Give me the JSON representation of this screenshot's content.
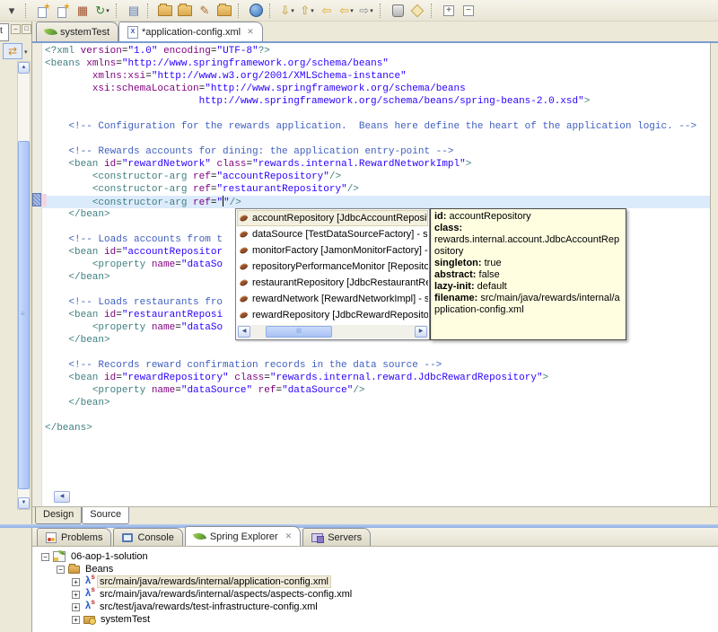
{
  "toolbar": {
    "groups": [
      [
        {
          "name": "cropped-overflow-dropdown",
          "glyph": "▾",
          "color": "#444444"
        }
      ],
      [
        {
          "name": "new-wizard",
          "cls": "g-star"
        },
        {
          "name": "new-bean-wizard",
          "cls": "g-star"
        },
        {
          "name": "new-package",
          "glyph": "▦",
          "color": "#a0522d"
        },
        {
          "name": "refresh",
          "glyph": "↻",
          "color": "#2f7f2f",
          "dd": true
        }
      ],
      [
        {
          "name": "open-view",
          "glyph": "▤",
          "color": "#5a7ab8"
        }
      ],
      [
        {
          "name": "open-resource-folder",
          "cls": "g-folder"
        },
        {
          "name": "import-folder",
          "cls": "g-folder"
        },
        {
          "name": "paintbrush",
          "glyph": "✎",
          "color": "#b06a2a"
        },
        {
          "name": "folder",
          "cls": "g-folder"
        }
      ],
      [
        {
          "name": "web-browser",
          "cls": "g-globe"
        }
      ],
      [
        {
          "name": "import",
          "glyph": "⇩",
          "color": "#b8962a",
          "dd": true
        },
        {
          "name": "export",
          "glyph": "⇧",
          "color": "#b8962a",
          "dd": true
        },
        {
          "name": "last-edit-location",
          "glyph": "⇦",
          "color": "#e0a72a"
        },
        {
          "name": "back",
          "glyph": "⇦",
          "color": "#e0a72a",
          "dd": true
        },
        {
          "name": "forward",
          "glyph": "⇨",
          "color": "#8a8f98",
          "dd": true
        }
      ],
      [
        {
          "name": "run-jar",
          "cls": "g-jar"
        },
        {
          "name": "bookmark-tag",
          "cls": "g-tag"
        }
      ],
      [
        {
          "name": "expand-all",
          "cls": "g-plus"
        },
        {
          "name": "collapse-all",
          "cls": "g-minus"
        }
      ]
    ]
  },
  "left_panel": {
    "truncated_tab_label": "t",
    "minimize_glyph": "–",
    "maximize_glyph": "□",
    "link_with_editor_glyph": "⇄",
    "menu_glyph": "▾"
  },
  "editor_tabs": [
    {
      "label": "systemTest",
      "icon": "spring-leaf-icon",
      "active": false
    },
    {
      "label": "*application-config.xml",
      "icon": "xml-file-icon",
      "active": true,
      "close_glyph": "✕"
    }
  ],
  "editor": {
    "cursor_line": 12,
    "lines": [
      [
        [
          "t",
          "<?xml "
        ],
        [
          "a",
          "version"
        ],
        [
          "x",
          "="
        ],
        [
          "v",
          "\"1.0\""
        ],
        [
          "x",
          " "
        ],
        [
          "a",
          "encoding"
        ],
        [
          "x",
          "="
        ],
        [
          "v",
          "\"UTF-8\""
        ],
        [
          "t",
          "?>"
        ]
      ],
      [
        [
          "t",
          "<beans "
        ],
        [
          "a",
          "xmlns"
        ],
        [
          "x",
          "="
        ],
        [
          "v",
          "\"http://www.springframework.org/schema/beans\""
        ]
      ],
      [
        [
          "x",
          "        "
        ],
        [
          "a",
          "xmlns:xsi"
        ],
        [
          "x",
          "="
        ],
        [
          "v",
          "\"http://www.w3.org/2001/XMLSchema-instance\""
        ]
      ],
      [
        [
          "x",
          "        "
        ],
        [
          "a",
          "xsi:schemaLocation"
        ],
        [
          "x",
          "="
        ],
        [
          "v",
          "\"http://www.springframework.org/schema/beans"
        ]
      ],
      [
        [
          "v",
          "                          http://www.springframework.org/schema/beans/spring-beans-2.0.xsd\""
        ],
        [
          "t",
          ">"
        ]
      ],
      [],
      [
        [
          "c",
          "    <!-- Configuration for the rewards application.  Beans here define the heart of the application logic. -->"
        ]
      ],
      [],
      [
        [
          "c",
          "    <!-- Rewards accounts for dining: the application entry-point -->"
        ]
      ],
      [
        [
          "x",
          "    "
        ],
        [
          "t",
          "<bean "
        ],
        [
          "a",
          "id"
        ],
        [
          "x",
          "="
        ],
        [
          "v",
          "\"rewardNetwork\""
        ],
        [
          "x",
          " "
        ],
        [
          "a",
          "class"
        ],
        [
          "x",
          "="
        ],
        [
          "v",
          "\"rewards.internal.RewardNetworkImpl\""
        ],
        [
          "t",
          ">"
        ]
      ],
      [
        [
          "x",
          "        "
        ],
        [
          "t",
          "<constructor-arg "
        ],
        [
          "a",
          "ref"
        ],
        [
          "x",
          "="
        ],
        [
          "v",
          "\"accountRepository\""
        ],
        [
          "t",
          "/>"
        ]
      ],
      [
        [
          "x",
          "        "
        ],
        [
          "t",
          "<constructor-arg "
        ],
        [
          "a",
          "ref"
        ],
        [
          "x",
          "="
        ],
        [
          "v",
          "\"restaurantRepository\""
        ],
        [
          "t",
          "/>"
        ]
      ],
      [
        [
          "x",
          "        "
        ],
        [
          "t",
          "<constructor-arg "
        ],
        [
          "a",
          "ref"
        ],
        [
          "x",
          "="
        ],
        [
          "v",
          "\""
        ],
        [
          "CURSOR",
          ""
        ],
        [
          "v",
          "\""
        ],
        [
          "t",
          "/>"
        ]
      ],
      [
        [
          "x",
          "    "
        ],
        [
          "t",
          "</bean>"
        ]
      ],
      [],
      [
        [
          "c",
          "    <!-- Loads accounts from t"
        ]
      ],
      [
        [
          "x",
          "    "
        ],
        [
          "t",
          "<bean "
        ],
        [
          "a",
          "id"
        ],
        [
          "x",
          "="
        ],
        [
          "v",
          "\"accountRepositor"
        ]
      ],
      [
        [
          "x",
          "        "
        ],
        [
          "t",
          "<property "
        ],
        [
          "a",
          "name"
        ],
        [
          "x",
          "="
        ],
        [
          "v",
          "\"dataSo"
        ]
      ],
      [
        [
          "x",
          "    "
        ],
        [
          "t",
          "</bean>"
        ]
      ],
      [],
      [
        [
          "c",
          "    <!-- Loads restaurants fro"
        ]
      ],
      [
        [
          "x",
          "    "
        ],
        [
          "t",
          "<bean "
        ],
        [
          "a",
          "id"
        ],
        [
          "x",
          "="
        ],
        [
          "v",
          "\"restaurantReposi"
        ]
      ],
      [
        [
          "x",
          "        "
        ],
        [
          "t",
          "<property "
        ],
        [
          "a",
          "name"
        ],
        [
          "x",
          "="
        ],
        [
          "v",
          "\"dataSo"
        ]
      ],
      [
        [
          "x",
          "    "
        ],
        [
          "t",
          "</bean>"
        ]
      ],
      [],
      [
        [
          "c",
          "    <!-- Records reward confirmation records in the data source -->"
        ]
      ],
      [
        [
          "x",
          "    "
        ],
        [
          "t",
          "<bean "
        ],
        [
          "a",
          "id"
        ],
        [
          "x",
          "="
        ],
        [
          "v",
          "\"rewardRepository\""
        ],
        [
          "x",
          " "
        ],
        [
          "a",
          "class"
        ],
        [
          "x",
          "="
        ],
        [
          "v",
          "\"rewards.internal.reward.JdbcRewardRepository\""
        ],
        [
          "t",
          ">"
        ]
      ],
      [
        [
          "x",
          "        "
        ],
        [
          "t",
          "<property "
        ],
        [
          "a",
          "name"
        ],
        [
          "x",
          "="
        ],
        [
          "v",
          "\"dataSource\""
        ],
        [
          "x",
          " "
        ],
        [
          "a",
          "ref"
        ],
        [
          "x",
          "="
        ],
        [
          "v",
          "\"dataSource\""
        ],
        [
          "t",
          "/>"
        ]
      ],
      [
        [
          "x",
          "    "
        ],
        [
          "t",
          "</bean>"
        ]
      ],
      [],
      [
        [
          "t",
          "</beans>"
        ]
      ]
    ]
  },
  "completion_popup": {
    "items": [
      {
        "icon": "bean-icon",
        "label": "accountRepository [JdbcAccountRepository] - src",
        "selected": true
      },
      {
        "icon": "bean-icon",
        "label": "dataSource [TestDataSourceFactory] - src/test/ja"
      },
      {
        "icon": "bean-icon",
        "label": "monitorFactory [JamonMonitorFactory] - src/main"
      },
      {
        "icon": "bean-icon",
        "label": "repositoryPerformanceMonitor [RepositoryPerfor"
      },
      {
        "icon": "bean-icon",
        "label": "restaurantRepository [JdbcRestaurantRepository"
      },
      {
        "icon": "bean-icon",
        "label": "rewardNetwork [RewardNetworkImpl] - src/main/j"
      },
      {
        "icon": "bean-icon",
        "label": "rewardRepository [JdbcRewardRepository] - src/r"
      }
    ]
  },
  "bean_tooltip": {
    "rows": [
      {
        "label": "id:",
        "value": " accountRepository"
      },
      {
        "label": "class:",
        "value": ""
      },
      {
        "label": "",
        "value": " rewards.internal.account.JdbcAccountRepository"
      },
      {
        "label": "singleton:",
        "value": " true"
      },
      {
        "label": "abstract:",
        "value": " false"
      },
      {
        "label": "lazy-init:",
        "value": " default"
      },
      {
        "label": "filename:",
        "value": " src/main/java/rewards/internal/application-config.xml"
      }
    ]
  },
  "editor_bottom_tabs": [
    {
      "label": "Design",
      "active": false
    },
    {
      "label": "Source",
      "active": true
    }
  ],
  "bottom_panel": {
    "tabs": [
      {
        "label": "Problems",
        "icon": "problems-icon",
        "active": false
      },
      {
        "label": "Console",
        "icon": "console-icon",
        "active": false
      },
      {
        "label": "Spring Explorer",
        "icon": "spring-leaf-icon",
        "active": true,
        "close_glyph": "✕"
      },
      {
        "label": "Servers",
        "icon": "servers-icon",
        "active": false
      }
    ],
    "tree": [
      {
        "indent": 0,
        "expander": "minus",
        "icon": "spring-project-icon",
        "label": "06-aop-1-solution",
        "selected": false
      },
      {
        "indent": 1,
        "expander": "minus",
        "icon": "beans-folder-icon",
        "label": "Beans",
        "selected": false
      },
      {
        "indent": 2,
        "expander": "plus",
        "icon": "spring-config-file-icon",
        "label": "src/main/java/rewards/internal/application-config.xml",
        "selected": true
      },
      {
        "indent": 2,
        "expander": "plus",
        "icon": "spring-config-file-icon",
        "label": "src/main/java/rewards/internal/aspects/aspects-config.xml",
        "selected": false
      },
      {
        "indent": 2,
        "expander": "plus",
        "icon": "spring-config-file-icon",
        "label": "src/test/java/rewards/test-infrastructure-config.xml",
        "selected": false
      },
      {
        "indent": 2,
        "expander": "plus",
        "icon": "config-set-icon",
        "label": "systemTest",
        "selected": false
      }
    ]
  },
  "colors": {
    "tag": "#3f7f7f",
    "attribute": "#7f007f",
    "value": "#2a00ff",
    "comment": "#3f5fbf",
    "current_line": "#dcebfb",
    "tooltip_bg": "#fffee1",
    "toolbar_bg": "#ece9d8",
    "sash_blue": "#8fafe2"
  }
}
